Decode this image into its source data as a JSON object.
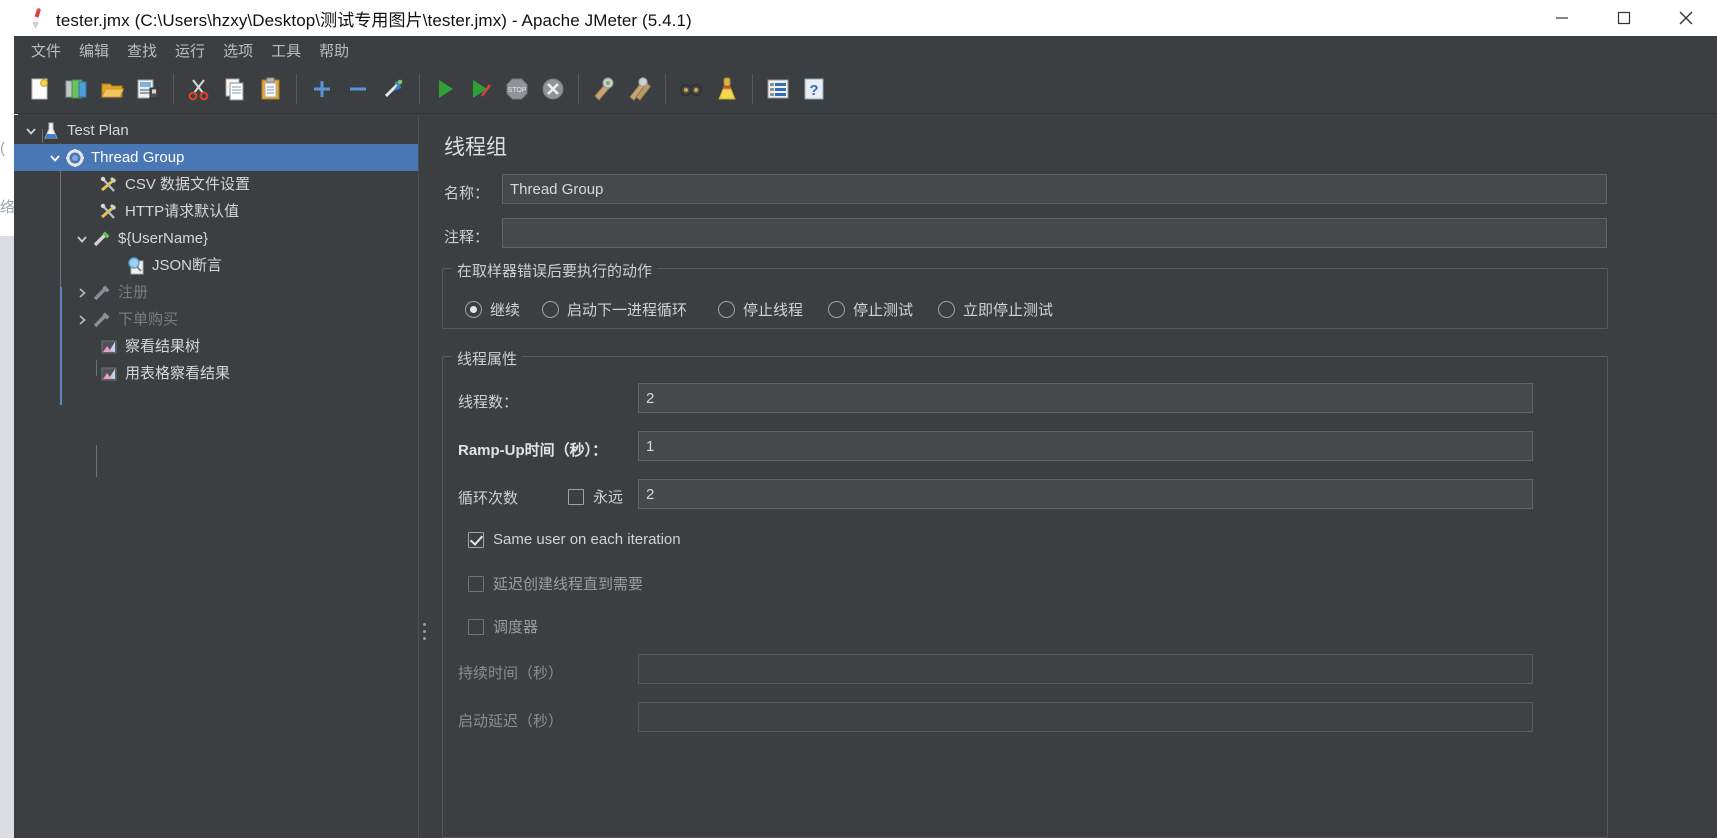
{
  "window": {
    "title": "tester.jmx (C:\\Users\\hzxy\\Desktop\\测试专用图片\\tester.jmx) - Apache JMeter (5.4.1)",
    "minimize_label": "最小化",
    "maximize_label": "最大化",
    "close_label": "关闭"
  },
  "desktop": {
    "ghost_a": "(",
    "ghost_b": "络"
  },
  "menu": {
    "items": [
      {
        "label": "文件"
      },
      {
        "label": "编辑"
      },
      {
        "label": "查找"
      },
      {
        "label": "运行"
      },
      {
        "label": "选项"
      },
      {
        "label": "工具"
      },
      {
        "label": "帮助"
      }
    ]
  },
  "toolbar": {
    "buttons": [
      {
        "name": "new-icon",
        "tip": "新建"
      },
      {
        "name": "templates-icon",
        "tip": "模板"
      },
      {
        "name": "open-icon",
        "tip": "打开"
      },
      {
        "name": "save-icon",
        "tip": "保存"
      },
      {
        "name": "cut-icon",
        "tip": "剪切"
      },
      {
        "name": "copy-icon",
        "tip": "复制"
      },
      {
        "name": "paste-icon",
        "tip": "粘贴"
      },
      {
        "name": "expand-all-icon",
        "tip": "展开全部"
      },
      {
        "name": "collapse-all-icon",
        "tip": "折叠全部"
      },
      {
        "name": "toggle-icon",
        "tip": "启用/禁用"
      },
      {
        "name": "start-icon",
        "tip": "启动"
      },
      {
        "name": "start-no-pauses-icon",
        "tip": "无暂停启动"
      },
      {
        "name": "stop-icon",
        "tip": "停止"
      },
      {
        "name": "shutdown-icon",
        "tip": "关闭"
      },
      {
        "name": "clear-icon",
        "tip": "清除"
      },
      {
        "name": "clear-all-icon",
        "tip": "清除全部"
      },
      {
        "name": "search-icon",
        "tip": "搜索"
      },
      {
        "name": "reset-search-icon",
        "tip": "重置搜索"
      },
      {
        "name": "function-helper-icon",
        "tip": "函数助手对话框"
      },
      {
        "name": "help-icon",
        "tip": "帮助"
      }
    ]
  },
  "tree": {
    "nodes": [
      {
        "label": "Test Plan",
        "icon": "test-plan-icon",
        "depth": 0,
        "twisty": "down",
        "selected": false,
        "disabled": false
      },
      {
        "label": "Thread Group",
        "icon": "thread-group-icon",
        "depth": 1,
        "twisty": "down",
        "selected": true,
        "disabled": false
      },
      {
        "label": "CSV 数据文件设置",
        "icon": "config-element-icon",
        "depth": 2,
        "twisty": "none",
        "selected": false,
        "disabled": false
      },
      {
        "label": "HTTP请求默认值",
        "icon": "config-element-icon",
        "depth": 2,
        "twisty": "none",
        "selected": false,
        "disabled": false
      },
      {
        "label": "${UserName}",
        "icon": "sampler-icon",
        "depth": 2,
        "twisty": "down",
        "selected": false,
        "disabled": false
      },
      {
        "label": "JSON断言",
        "icon": "assertion-icon",
        "depth": 3,
        "twisty": "none",
        "selected": false,
        "disabled": false
      },
      {
        "label": "注册",
        "icon": "sampler-icon",
        "depth": 2,
        "twisty": "right",
        "selected": false,
        "disabled": true
      },
      {
        "label": "下单购买",
        "icon": "sampler-icon",
        "depth": 2,
        "twisty": "right",
        "selected": false,
        "disabled": true
      },
      {
        "label": "察看结果树",
        "icon": "listener-icon",
        "depth": 2,
        "twisty": "none",
        "selected": false,
        "disabled": false
      },
      {
        "label": "用表格察看结果",
        "icon": "listener-icon",
        "depth": 2,
        "twisty": "none",
        "selected": false,
        "disabled": false
      }
    ]
  },
  "detail": {
    "panel_title": "线程组",
    "name_label": "名称：",
    "name_value": "Thread Group",
    "comment_label": "注释：",
    "comment_value": "",
    "error_action": {
      "legend": "在取样器错误后要执行的动作",
      "options": [
        {
          "label": "继续",
          "checked": true
        },
        {
          "label": "启动下一进程循环",
          "checked": false
        },
        {
          "label": "停止线程",
          "checked": false
        },
        {
          "label": "停止测试",
          "checked": false
        },
        {
          "label": "立即停止测试",
          "checked": false
        }
      ]
    },
    "thread_properties": {
      "legend": "线程属性",
      "threads_label": "线程数：",
      "threads_value": "2",
      "rampup_label": "Ramp-Up时间（秒）：",
      "rampup_value": "1",
      "loop_label": "循环次数",
      "loop_forever_label": "永远",
      "loop_forever_checked": false,
      "loop_value": "2",
      "same_user_label": "Same user on each iteration",
      "same_user_checked": true,
      "delayed_start_label": "延迟创建线程直到需要",
      "delayed_start_checked": false,
      "scheduler_label": "调度器",
      "scheduler_checked": false,
      "duration_label": "持续时间（秒）",
      "duration_value": "",
      "startup_delay_label": "启动延迟（秒）",
      "startup_delay_value": ""
    }
  },
  "colors": {
    "window_bg": "#3c3f41",
    "selection": "#4a77b5",
    "text": "#d6d6d6",
    "disabled_text": "#787c80",
    "field_bg": "#45494b",
    "border": "#55595c"
  }
}
